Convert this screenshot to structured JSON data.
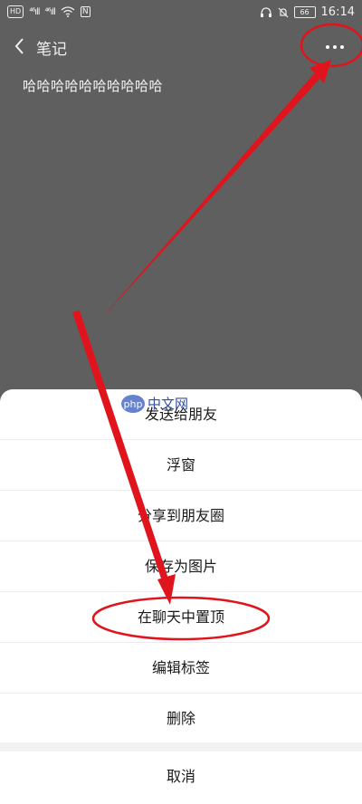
{
  "status": {
    "left_badge": "HD",
    "signal1": "⁴⁶ıll",
    "signal2": "⁴⁶ıll",
    "time": "16:14",
    "battery": "66"
  },
  "header": {
    "title": "笔记"
  },
  "note": {
    "content": "哈哈哈哈哈哈哈哈哈哈"
  },
  "menu": {
    "items": [
      "发送给朋友",
      "浮窗",
      "分享到朋友圈",
      "保存为图片",
      "在聊天中置顶",
      "编辑标签",
      "删除"
    ],
    "cancel": "取消"
  },
  "watermark": {
    "brand": "php",
    "site": "中文网"
  },
  "colors": {
    "annotation": "#e0141c",
    "overlay_bg": "#5f5f5f"
  }
}
